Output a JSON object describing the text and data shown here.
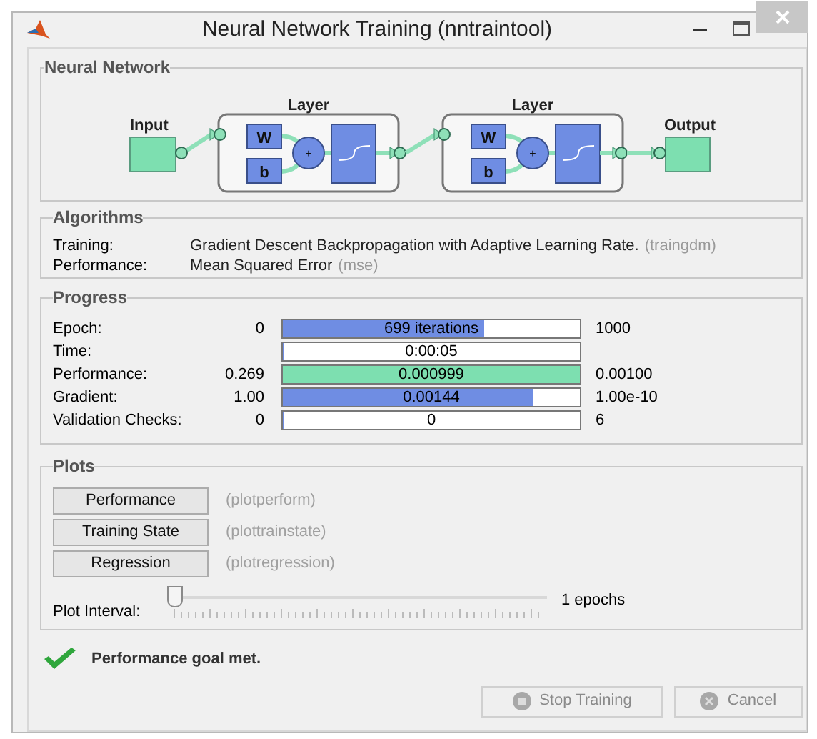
{
  "window": {
    "title": "Neural Network Training (nntraintool)"
  },
  "network": {
    "title": "Neural Network",
    "input": "Input",
    "output": "Output",
    "layers": [
      {
        "title": "Layer",
        "weight": "W",
        "bias": "b",
        "sum": "+"
      },
      {
        "title": "Layer",
        "weight": "W",
        "bias": "b",
        "sum": "+"
      }
    ]
  },
  "algorithms": {
    "title": "Algorithms",
    "rows": [
      {
        "label": "Training:",
        "value": "Gradient Descent Backpropagation with Adaptive Learning Rate.",
        "function": "(traingdm)"
      },
      {
        "label": "Performance:",
        "value": "Mean Squared Error",
        "function": "(mse)"
      }
    ]
  },
  "progress": {
    "title": "Progress",
    "rows": [
      {
        "label": "Epoch:",
        "start": "0",
        "reading": "699 iterations",
        "end": "1000",
        "level": 0.68,
        "color": "#6f8de3"
      },
      {
        "label": "Time:",
        "reading": "0:00:05",
        "level": 0,
        "color": "#6f8de3"
      },
      {
        "label": "Performance:",
        "start": "0.269",
        "reading": "0.000999",
        "end": "0.00100",
        "level": 1,
        "color": "#7ddfb0"
      },
      {
        "label": "Gradient:",
        "start": "1.00",
        "reading": "0.00144",
        "end": "1.00e-10",
        "level": 0.84,
        "color": "#6f8de3"
      },
      {
        "label": "Validation Checks:",
        "start": "0",
        "reading": "0",
        "end": "6",
        "level": 0,
        "color": "#6f8de3"
      }
    ]
  },
  "plots": {
    "title": "Plots",
    "buttons": [
      {
        "label": "Performance",
        "function": "(plotperform)"
      },
      {
        "label": "Training State",
        "function": "(plottrainstate)"
      },
      {
        "label": "Regression",
        "function": "(plotregression)"
      }
    ],
    "interval": {
      "label": "Plot Interval:",
      "level": 0,
      "reading": "1 epochs"
    }
  },
  "status": {
    "message": "Performance goal met.",
    "success": true
  },
  "buttons": [
    {
      "label": "Stop Training",
      "kind": "stop",
      "disabled": true
    },
    {
      "label": "Cancel",
      "kind": "cancel",
      "disabled": true
    }
  ]
}
